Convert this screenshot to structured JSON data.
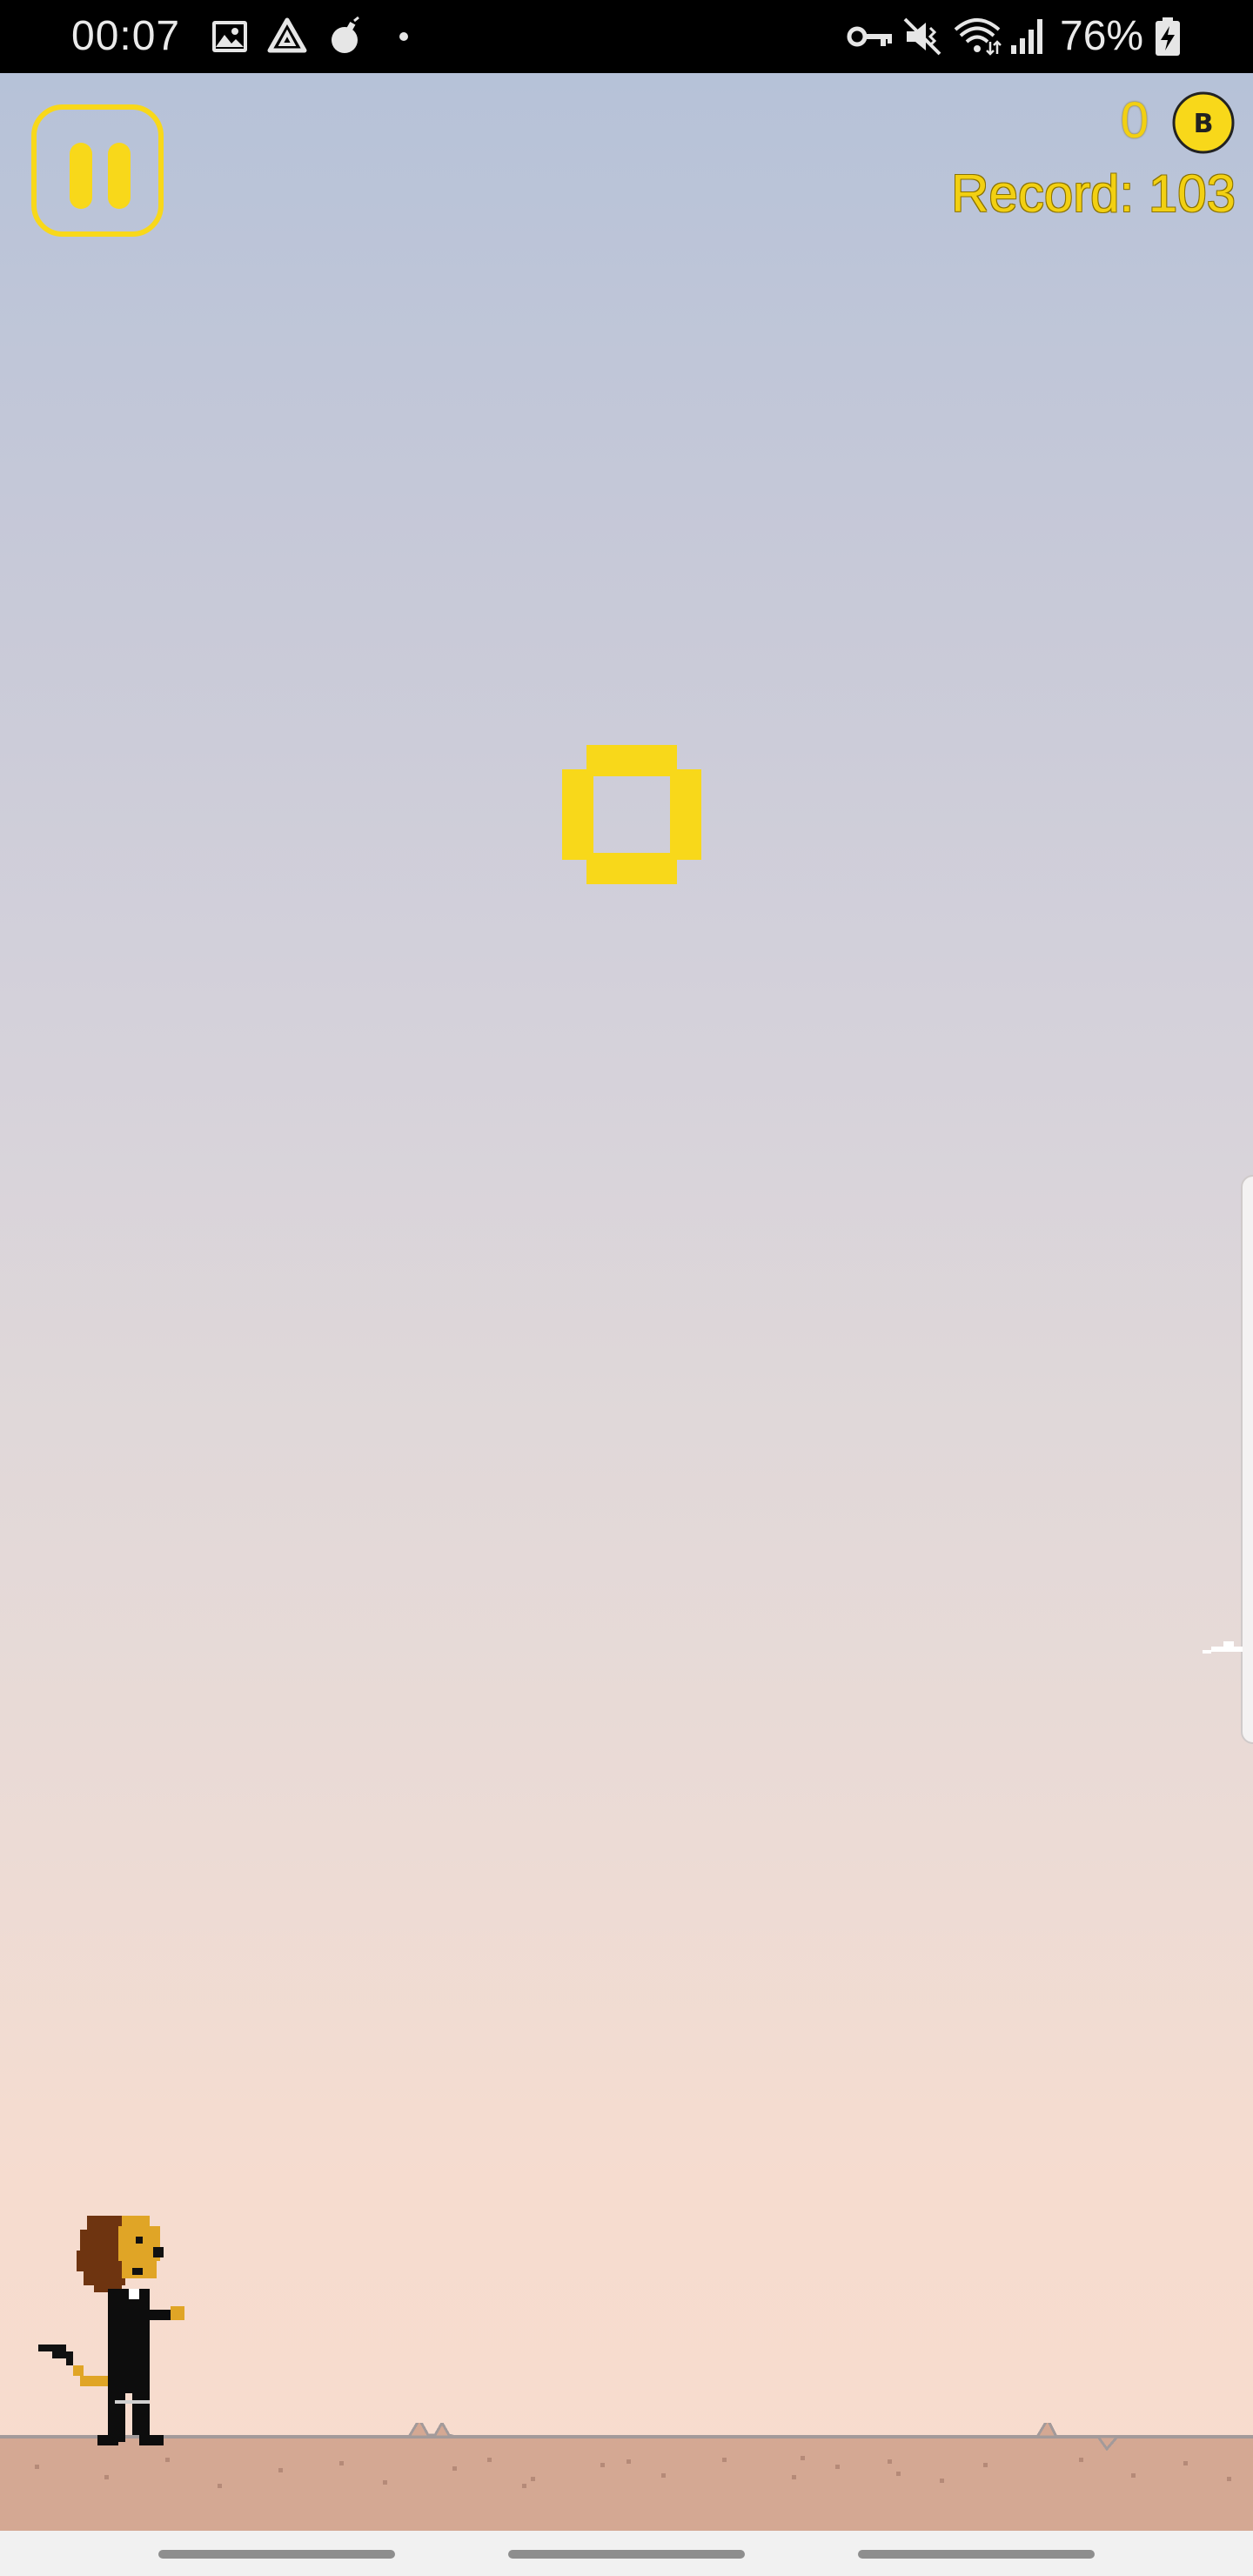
{
  "status_bar": {
    "time": "00:07",
    "battery_percent": "76%",
    "left_icons": [
      "gallery-icon",
      "drive-icon",
      "bomb-icon",
      "dot-icon"
    ],
    "right_icons": [
      "vpn-key-icon",
      "mute-icon",
      "wifi-icon",
      "signal-icon",
      "battery-charging-icon"
    ]
  },
  "hud": {
    "coins": "0",
    "coin_letter": "B",
    "record": "Record: 103"
  },
  "colors": {
    "accent_yellow": "#f8d81a",
    "ground": "#d4a893",
    "sky_top": "#b6c2d8",
    "sky_bottom": "#f8dcce"
  },
  "nav_bar": {
    "handles": 3
  }
}
